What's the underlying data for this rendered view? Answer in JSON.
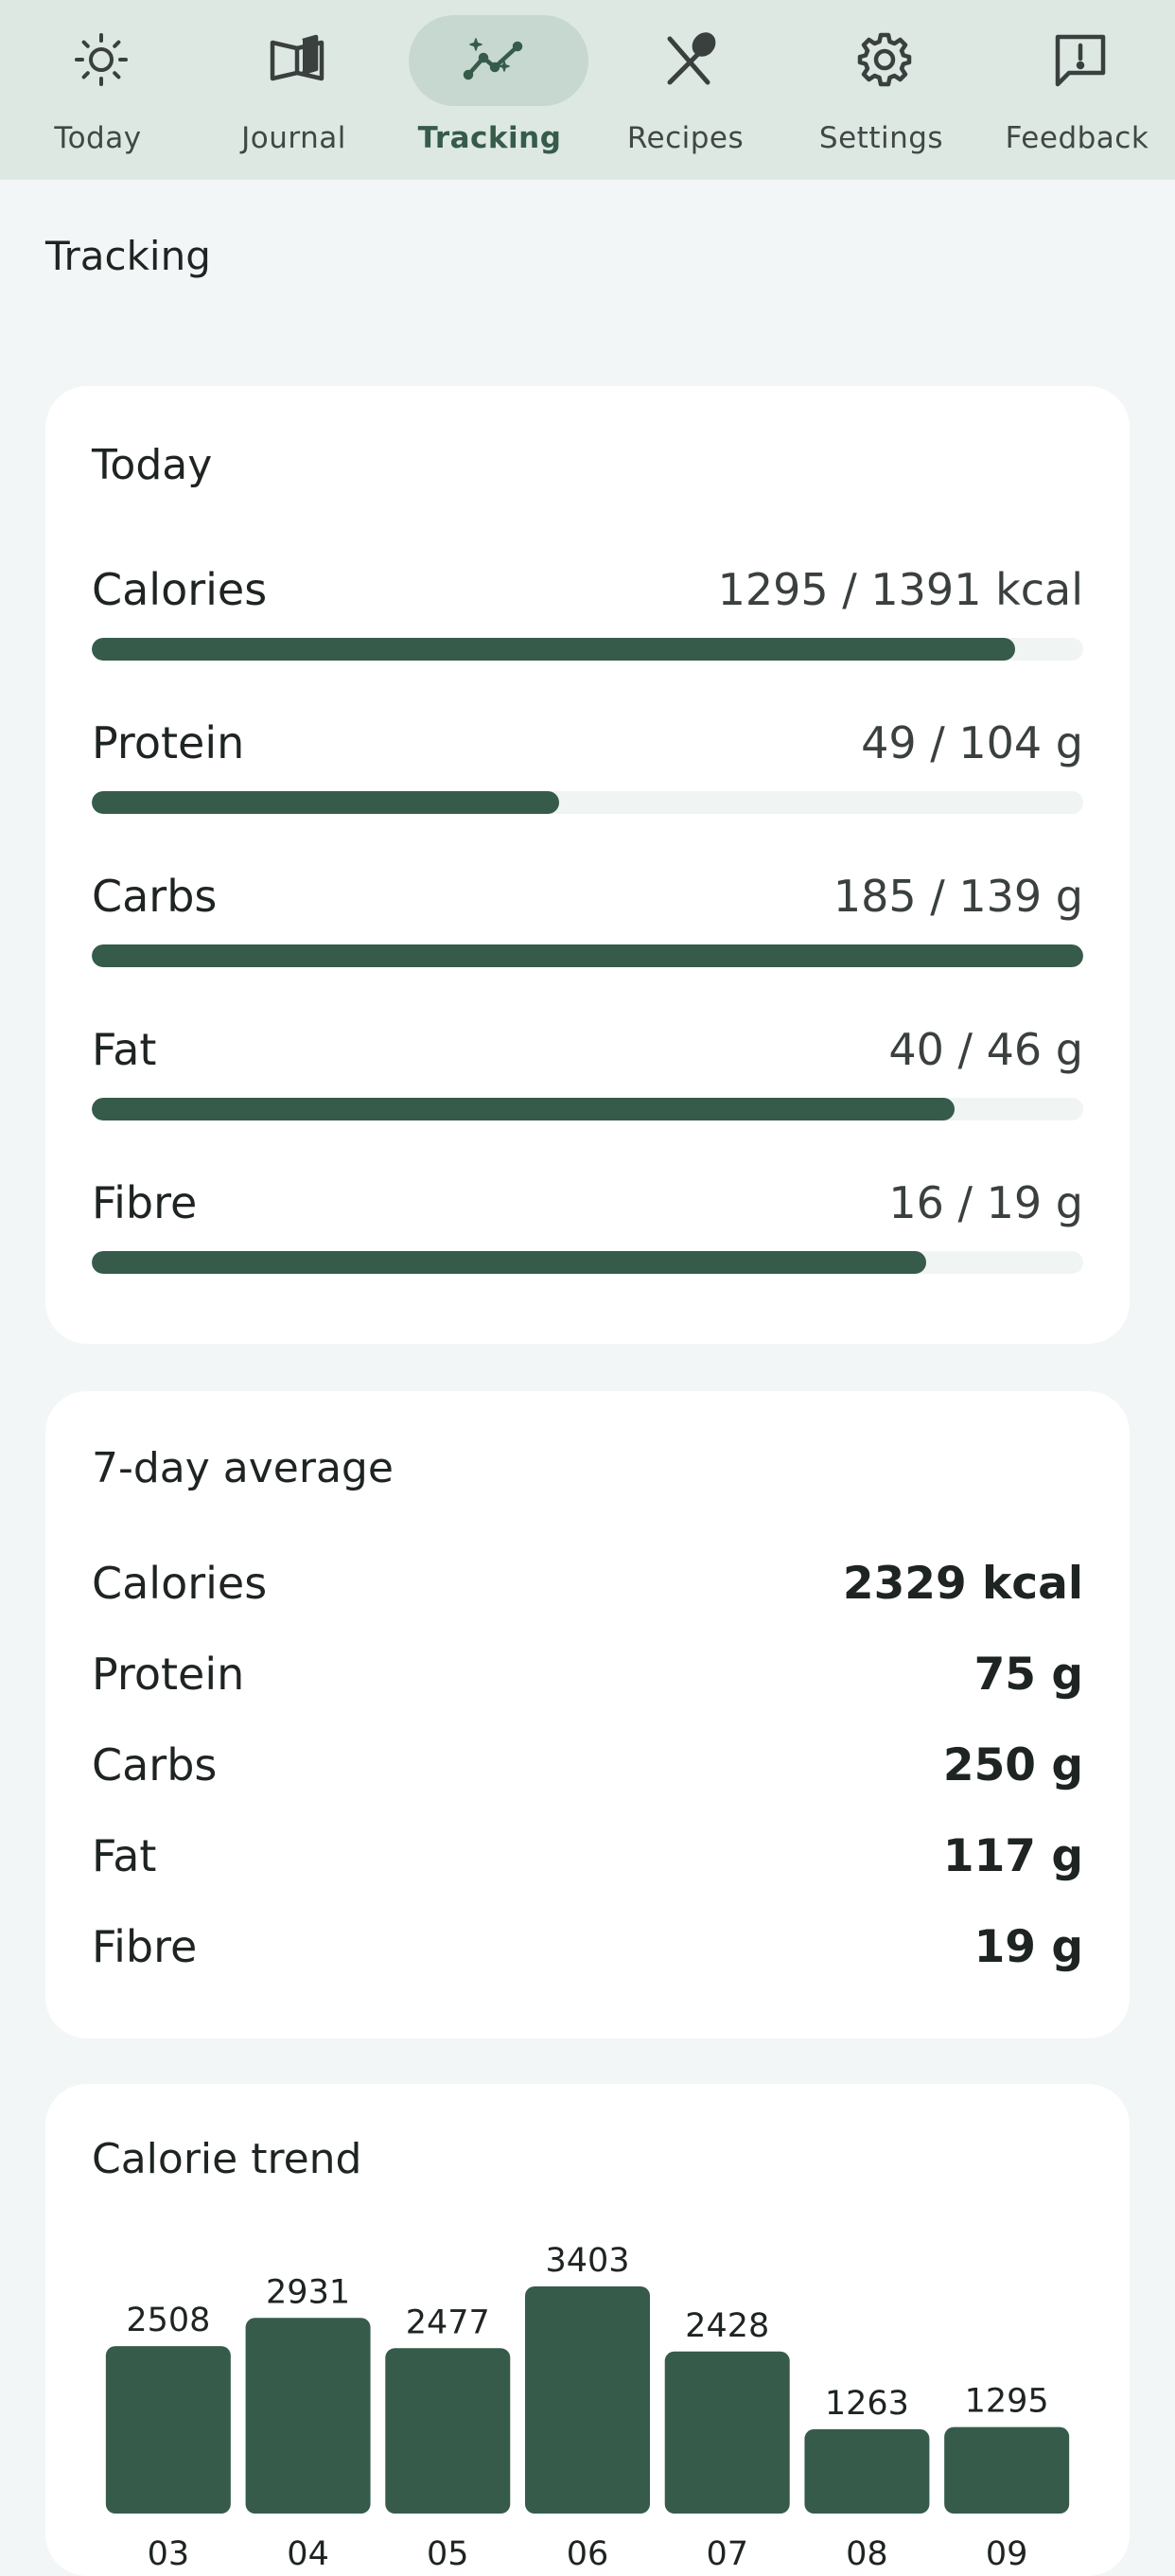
{
  "nav": {
    "items": [
      {
        "label": "Today",
        "icon": "sun-icon",
        "active": false
      },
      {
        "label": "Journal",
        "icon": "book-open-icon",
        "active": false
      },
      {
        "label": "Tracking",
        "icon": "trend-chart-icon",
        "active": true
      },
      {
        "label": "Recipes",
        "icon": "utensils-icon",
        "active": false
      },
      {
        "label": "Settings",
        "icon": "gear-icon",
        "active": false
      },
      {
        "label": "Feedback",
        "icon": "feedback-icon",
        "active": false
      }
    ]
  },
  "page": {
    "title": "Tracking"
  },
  "today": {
    "title": "Today",
    "macros": [
      {
        "name": "Calories",
        "value": "1295 / 1391 kcal",
        "progress": 0.931
      },
      {
        "name": "Protein",
        "value": "49 / 104 g",
        "progress": 0.471
      },
      {
        "name": "Carbs",
        "value": "185 / 139 g",
        "progress": 1.0
      },
      {
        "name": "Fat",
        "value": "40 / 46 g",
        "progress": 0.87
      },
      {
        "name": "Fibre",
        "value": "16 / 19 g",
        "progress": 0.842
      }
    ]
  },
  "average": {
    "title": "7-day average",
    "rows": [
      {
        "name": "Calories",
        "value": "2329 kcal"
      },
      {
        "name": "Protein",
        "value": "75 g"
      },
      {
        "name": "Carbs",
        "value": "250 g"
      },
      {
        "name": "Fat",
        "value": "117 g"
      },
      {
        "name": "Fibre",
        "value": "19 g"
      }
    ]
  },
  "trend": {
    "title": "Calorie trend"
  },
  "chart_data": {
    "type": "bar",
    "categories": [
      "03",
      "04",
      "05",
      "06",
      "07",
      "08",
      "09"
    ],
    "values": [
      2508,
      2931,
      2477,
      3403,
      2428,
      1263,
      1295
    ],
    "ylim": [
      0,
      3403
    ],
    "grid": false,
    "bar_color": "#365b4a"
  },
  "colors": {
    "accent": "#365b4a",
    "nav_background": "#dde8e3",
    "nav_active_pill": "#c7d8d0",
    "page_background": "#f2f6f6",
    "card_background": "#ffffff",
    "track_background": "#f0f4f2"
  }
}
